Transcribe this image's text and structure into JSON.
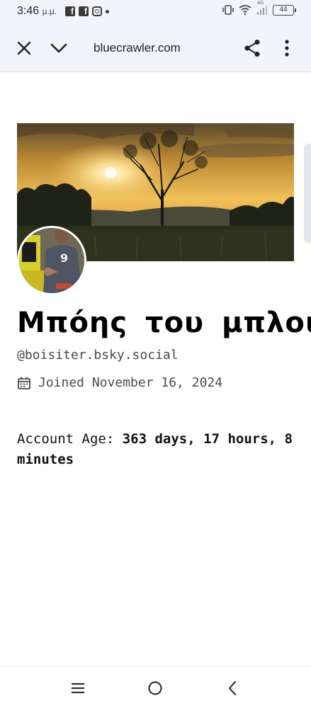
{
  "status_bar": {
    "time": "3:46",
    "ampm": "μ.μ.",
    "battery": "44",
    "network": "4G"
  },
  "browser": {
    "url": "bluecrawler.com"
  },
  "profile": {
    "display_name": "Μπόης του μπλου",
    "handle": "@boisiter.bsky.social",
    "joined": "Joined November 16, 2024",
    "account_age_label": "Account Age:",
    "account_age_value": "363 days, 17 hours, 8 minutes"
  },
  "colors": {
    "chrome_bg": "#f3f4fb",
    "text_muted": "#4a4a4a",
    "sky_gold": "#e8a93a"
  },
  "icons": {
    "close": "close-icon",
    "chevron": "chevron-down-icon",
    "share": "share-icon",
    "menu": "more-vert-icon",
    "calendar": "calendar-icon"
  }
}
